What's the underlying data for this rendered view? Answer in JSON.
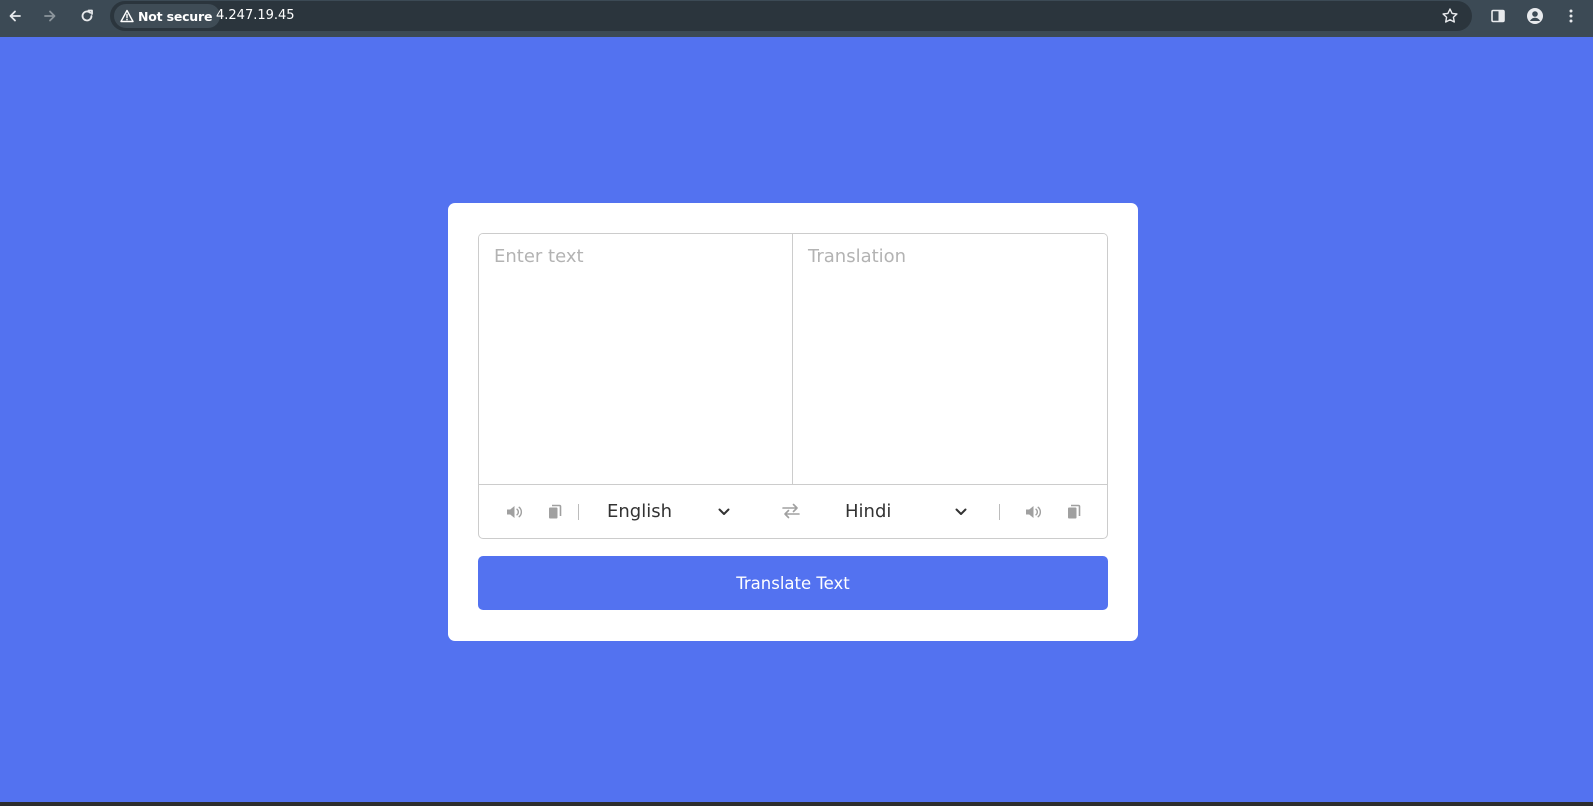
{
  "browser": {
    "security_label": "Not secure",
    "url": "4.247.19.45",
    "icons": [
      "back-arrow-icon",
      "forward-arrow-icon",
      "reload-icon",
      "warning-icon",
      "star-icon",
      "side-panel-icon",
      "profile-icon",
      "menu-dots-icon"
    ]
  },
  "translator": {
    "from_placeholder": "Enter text",
    "to_placeholder": "Translation",
    "from_language": "English",
    "to_language": "Hindi",
    "button_label": "Translate Text",
    "icons": [
      "speaker-icon",
      "copy-icon",
      "chevron-down-icon",
      "swap-arrows-icon"
    ]
  },
  "colors": {
    "page_background": "#5372F0",
    "button_background": "#5372F0",
    "card_background": "#FFFFFF",
    "browser_chrome": "#3C4A55",
    "icon_grey": "#9E9E9E"
  }
}
